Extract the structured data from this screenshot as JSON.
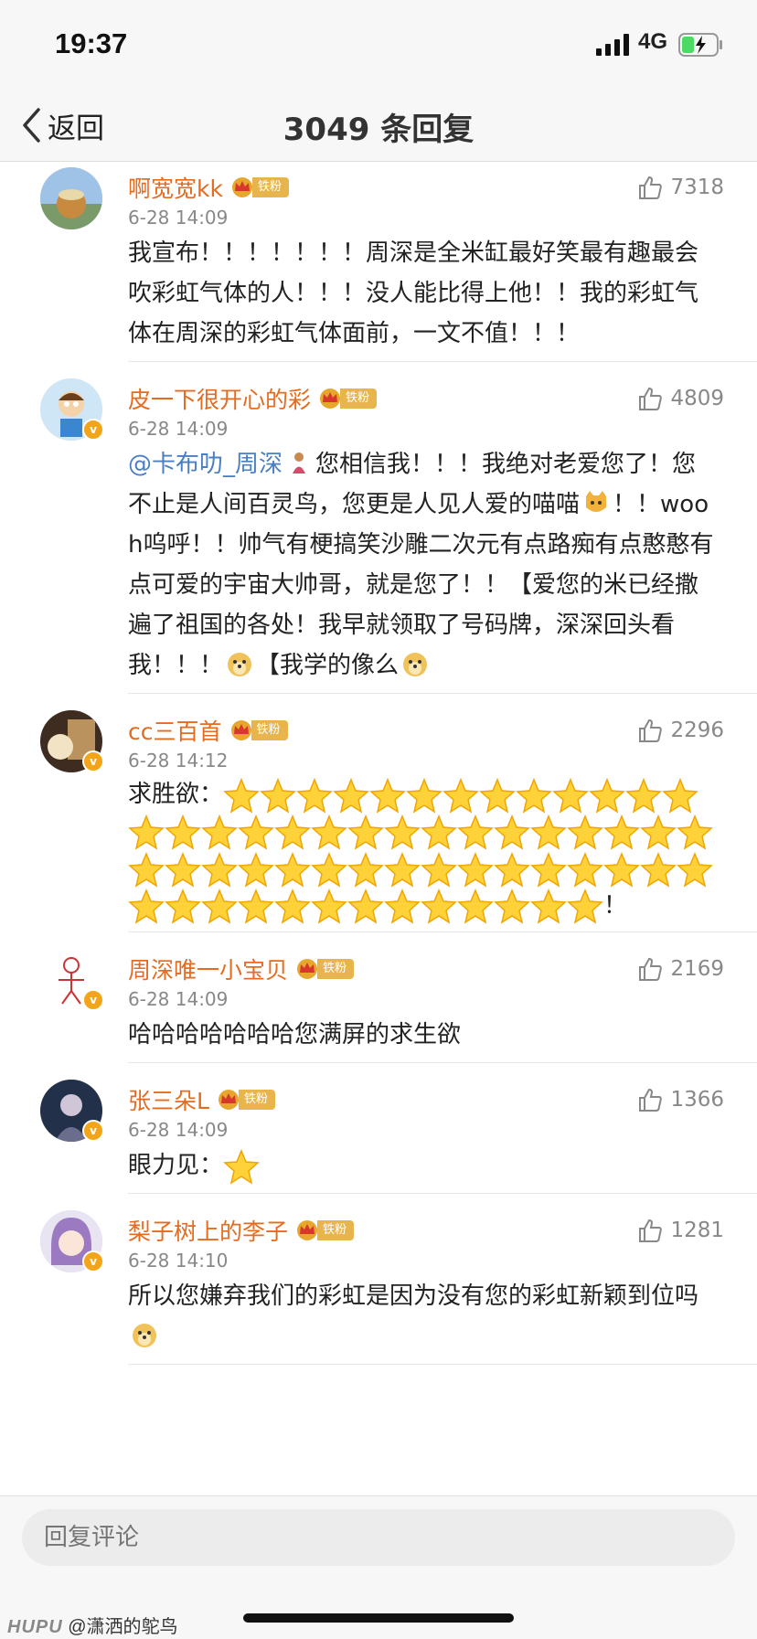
{
  "status_bar": {
    "time": "19:37",
    "network": "4G"
  },
  "nav": {
    "back_label": "返回",
    "title": "3049 条回复"
  },
  "badge_label": "铁粉",
  "comments": [
    {
      "user": "啊宽宽kk",
      "time": "6-28 14:09",
      "likes": "7318",
      "verified": false,
      "text": "我宣布！！！！！！！周深是全米缸最好笑最有趣最会吹彩虹气体的人！！！没人能比得上他！！我的彩虹气体在周深的彩虹气体面前，一文不值！！！"
    },
    {
      "user": "皮一下很开心的彩",
      "time": "6-28 14:09",
      "likes": "4809",
      "verified": true,
      "mention": "@卡布叻_周深",
      "text_parts": [
        "您相信我！！！我绝对老爱您了！您不止是人间百灵鸟，您更是人见人爱的喵喵",
        "！！wooh呜呼！！帅气有梗搞笑沙雕二次元有点路痴有点憨憨有点可爱的宇宙大帅哥，就是您了！！【爱您的米已经撒遍了祖国的各处！我早就领取了号码牌，深深回头看我！！！",
        "【我学的像么"
      ]
    },
    {
      "user": "cc三百首",
      "time": "6-28 14:12",
      "likes": "2296",
      "verified": true,
      "text": "求胜欲：",
      "star_count": 58,
      "text_end": "！"
    },
    {
      "user": "周深唯一小宝贝",
      "time": "6-28 14:09",
      "likes": "2169",
      "verified": true,
      "text": "哈哈哈哈哈哈哈您满屏的求生欲"
    },
    {
      "user": "张三朵L",
      "time": "6-28 14:09",
      "likes": "1366",
      "verified": true,
      "text": "眼力见："
    },
    {
      "user": "梨子树上的李子",
      "time": "6-28 14:10",
      "likes": "1281",
      "verified": true,
      "text": "所以您嫌弃我们的彩虹是因为没有您的彩虹新颖到位吗"
    }
  ],
  "reply_placeholder": "回复评论",
  "watermark": {
    "brand": "HUPU",
    "author": "@潇洒的鸵鸟"
  },
  "colors": {
    "username": "#e56b1f",
    "mention": "#4a7fc1",
    "fan_badge": "#e8b54d"
  },
  "icons": [
    "thumb-up-icon",
    "crown-icon",
    "verified-icon",
    "star-emoji",
    "doge-emoji",
    "cat-emoji",
    "person-emoji"
  ]
}
